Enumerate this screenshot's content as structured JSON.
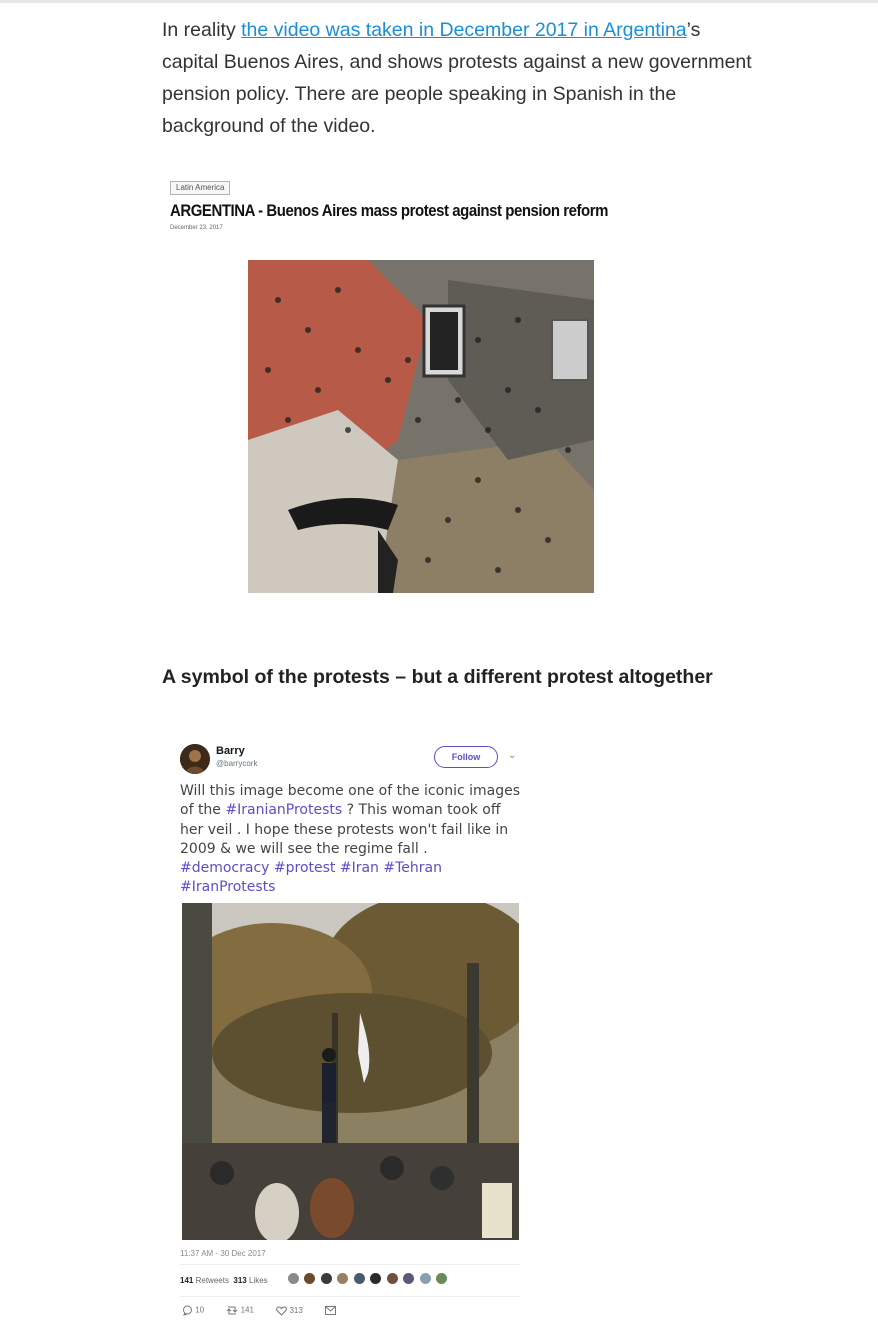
{
  "intro": {
    "prefix": "In reality ",
    "link_text": "the video was taken in December 2017 in Argentina",
    "suffix": "’s capital Buenos Aires, and shows protests against a new government pension policy. There are people speaking in Spanish in the background of the video."
  },
  "embed": {
    "tag": "Latin America",
    "headline": "ARGENTINA - Buenos Aires mass protest against pension reform",
    "date": "December 23, 2017"
  },
  "section_heading": "A symbol of the protests – but a different protest altogether",
  "tweet": {
    "name": "Barry",
    "handle": "@barrycork",
    "follow_label": "Follow",
    "text_1": "Will this image become one of the iconic images of the ",
    "hashtag_1": "#IranianProtests",
    "text_2": " ? This woman took off her veil  . I hope these protests won't fail like in 2009 & we will see the regime fall . ",
    "hashtags_2": "#democracy #protest #Iran #Tehran #IranProtests",
    "timestamp": "11:37 AM - 30 Dec 2017",
    "retweets_count": "141",
    "retweets_label": "Retweets",
    "likes_count": "313",
    "likes_label": "Likes",
    "reply_count": "10",
    "retweet_action_count": "141",
    "like_action_count": "313"
  },
  "colors": {
    "link": "#1a8fd6",
    "twitter_accent": "#5a4fc7"
  }
}
